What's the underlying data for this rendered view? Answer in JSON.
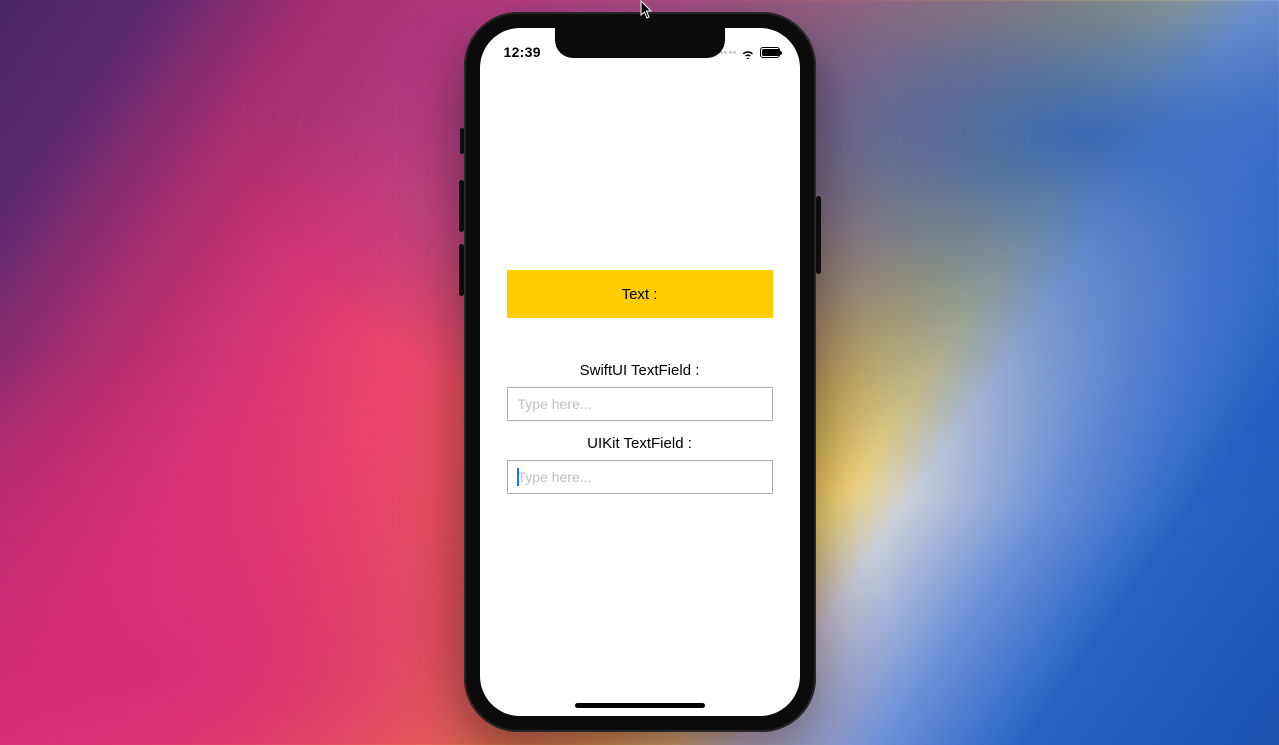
{
  "statusbar": {
    "time": "12:39"
  },
  "banner": {
    "label": "Text :"
  },
  "fields": {
    "swiftui": {
      "label": "SwiftUI TextField :",
      "placeholder": "Type here...",
      "value": ""
    },
    "uikit": {
      "label": "UIKit TextField :",
      "placeholder": "Type here...",
      "value": ""
    }
  }
}
